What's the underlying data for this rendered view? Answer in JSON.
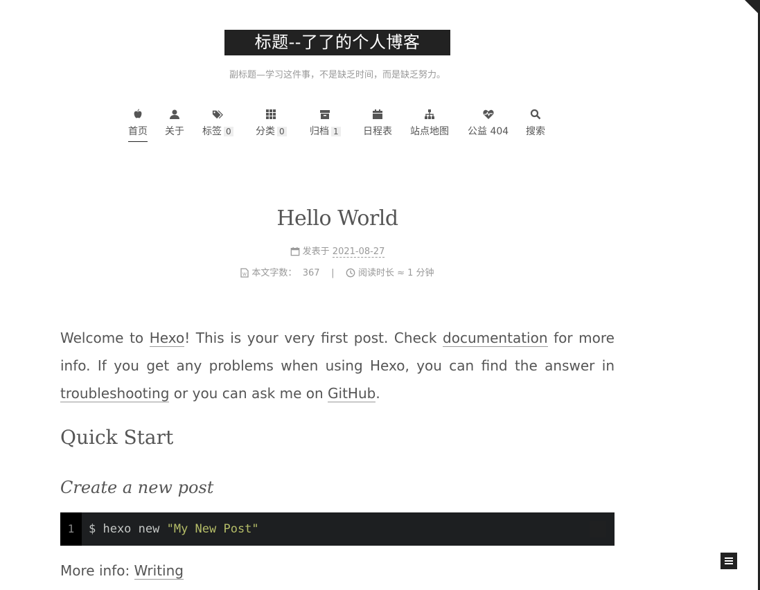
{
  "site": {
    "title": "标题--了了的个人博客",
    "subtitle": "副标题—学习这件事，不是缺乏时间，而是缺乏努力。"
  },
  "menu": [
    {
      "label": "首页",
      "icon": "apple-icon",
      "badge": ""
    },
    {
      "label": "关于",
      "icon": "user-icon",
      "badge": ""
    },
    {
      "label": "标签",
      "icon": "tags-icon",
      "badge": "0"
    },
    {
      "label": "分类",
      "icon": "grid-icon",
      "badge": "0"
    },
    {
      "label": "归档",
      "icon": "archive-icon",
      "badge": "1"
    },
    {
      "label": "日程表",
      "icon": "calendar-icon",
      "badge": ""
    },
    {
      "label": "站点地图",
      "icon": "sitemap-icon",
      "badge": ""
    },
    {
      "label": "公益 404",
      "icon": "heartbeat-icon",
      "badge": ""
    },
    {
      "label": "搜索",
      "icon": "search-icon",
      "badge": ""
    }
  ],
  "post": {
    "title": "Hello World",
    "posted_label": "发表于",
    "date": "2021-08-27",
    "wordcount_label": "本文字数：",
    "wordcount": "367",
    "separator": "|",
    "readtime_label": "阅读时长 ≈",
    "readtime": "1 分钟"
  },
  "content": {
    "p1_a": "Welcome to ",
    "link_hexo": "Hexo",
    "p1_b": "! This is your very first post. Check ",
    "link_docs": "documentation",
    "p1_c": " for more info. If you get any problems when using Hexo, you can find the answer in ",
    "link_trouble": "troubleshooting",
    "p1_d": " or you can ask me on ",
    "link_github": "GitHub",
    "p1_e": ".",
    "h2": "Quick Start",
    "h3": "Create a new post",
    "code_line_no": "1",
    "code_cmd": "$ hexo new ",
    "code_str": "\"My New Post\"",
    "more_label": "More info: ",
    "more_link": "Writing"
  },
  "colors": {
    "accent": "#222222",
    "text": "#555555",
    "muted": "#999999",
    "code_bg": "#1d1f21",
    "code_str": "#b5bd68"
  }
}
